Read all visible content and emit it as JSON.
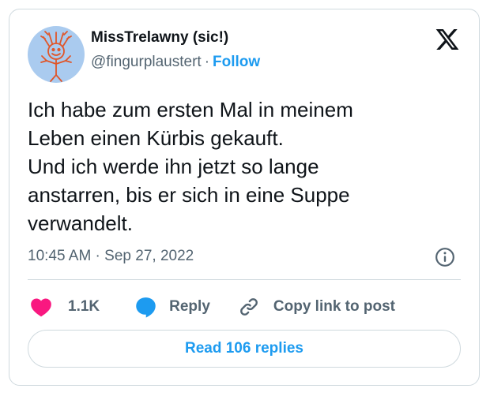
{
  "author": {
    "display_name": "MissTrelawny (sic!)",
    "handle": "@fingurplaustert",
    "separator": "·",
    "follow_label": "Follow"
  },
  "tweet": {
    "lines": [
      "Ich habe zum ersten Mal in meinem",
      "Leben einen Kürbis gekauft.",
      "Und ich werde ihn jetzt so lange",
      "anstarren, bis er sich in eine Suppe",
      "verwandelt."
    ],
    "timestamp": "10:45 AM · Sep 27, 2022"
  },
  "actions": {
    "like_count": "1.1K",
    "reply_label": "Reply",
    "copy_label": "Copy link to post"
  },
  "footer": {
    "read_replies_label": "Read 106 replies"
  },
  "icons": {
    "brand": "x-logo-icon",
    "info": "info-icon",
    "like": "heart-icon",
    "reply": "speech-bubble-icon",
    "copy": "link-icon"
  },
  "colors": {
    "accent": "#1d9bf0",
    "like": "#f91880",
    "text": "#0f1419",
    "muted": "#536471",
    "border": "#cfd9de",
    "avatar_bg": "#aacbef"
  }
}
